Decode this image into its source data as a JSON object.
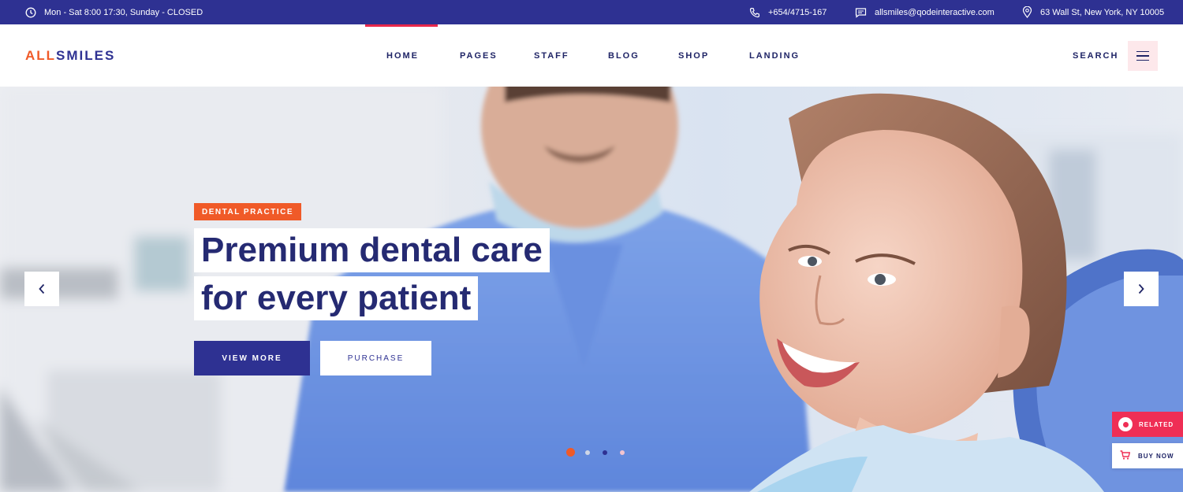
{
  "topbar": {
    "hours": "Mon - Sat 8:00 17:30, Sunday - CLOSED",
    "phone": "+654/4715-167",
    "email": "allsmiles@qodeinteractive.com",
    "address": "63 Wall St, New York, NY 10005",
    "icons": [
      "clock-icon",
      "phone-icon",
      "message-icon",
      "location-pin-icon"
    ]
  },
  "header": {
    "logo": {
      "part1": "ALL",
      "part2": "SMILES"
    },
    "nav": [
      {
        "label": "HOME",
        "active": true
      },
      {
        "label": "PAGES",
        "active": false
      },
      {
        "label": "STAFF",
        "active": false
      },
      {
        "label": "BLOG",
        "active": false
      },
      {
        "label": "SHOP",
        "active": false
      },
      {
        "label": "LANDING",
        "active": false
      }
    ],
    "search_label": "SEARCH",
    "menu_icon": "hamburger-icon"
  },
  "hero": {
    "badge": "DENTAL PRACTICE",
    "headline_line1": "Premium dental care",
    "headline_line2": "for every patient",
    "primary_button": "VIEW MORE",
    "secondary_button": "PURCHASE",
    "prev_icon": "chevron-left-icon",
    "next_icon": "chevron-right-icon",
    "slide_count": 4,
    "active_slide": 1
  },
  "widgets": {
    "related_label": "RELATED",
    "buy_now_label": "BUY NOW"
  },
  "colors": {
    "brand_navy": "#2e3192",
    "accent_orange": "#f05a28",
    "accent_red": "#e8274b",
    "text_navy": "#1f2466",
    "menu_bg": "#fde8eb"
  }
}
